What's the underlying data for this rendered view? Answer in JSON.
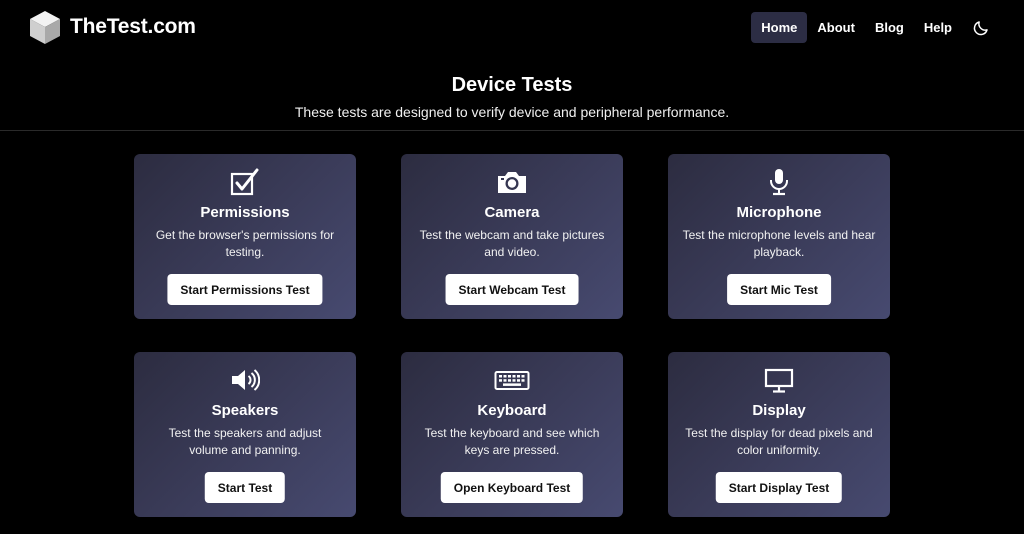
{
  "header": {
    "brand": "TheTest.com",
    "nav": [
      {
        "label": "Home",
        "active": true
      },
      {
        "label": "About",
        "active": false
      },
      {
        "label": "Blog",
        "active": false
      },
      {
        "label": "Help",
        "active": false
      }
    ],
    "theme_icon": "moon-icon"
  },
  "hero": {
    "title": "Device Tests",
    "subtitle": "These tests are designed to verify device and peripheral performance."
  },
  "cards": [
    {
      "icon": "checkbox-icon",
      "title": "Permissions",
      "description": "Get the browser's permissions for testing.",
      "button": "Start Permissions Test"
    },
    {
      "icon": "camera-icon",
      "title": "Camera",
      "description": "Test the webcam and take pictures and video.",
      "button": "Start Webcam Test"
    },
    {
      "icon": "microphone-icon",
      "title": "Microphone",
      "description": "Test the microphone levels and hear playback.",
      "button": "Start Mic Test"
    },
    {
      "icon": "speaker-icon",
      "title": "Speakers",
      "description": "Test the speakers and adjust volume and panning.",
      "button": "Start Test"
    },
    {
      "icon": "keyboard-icon",
      "title": "Keyboard",
      "description": "Test the keyboard and see which keys are pressed.",
      "button": "Open Keyboard Test"
    },
    {
      "icon": "monitor-icon",
      "title": "Display",
      "description": "Test the display for dead pixels and color uniformity.",
      "button": "Start Display Test"
    }
  ],
  "colors": {
    "background": "#000000",
    "card_gradient_start": "#2c2c40",
    "card_gradient_end": "#474a70",
    "active_nav": "#2c2d44",
    "button_bg": "#ffffff"
  }
}
